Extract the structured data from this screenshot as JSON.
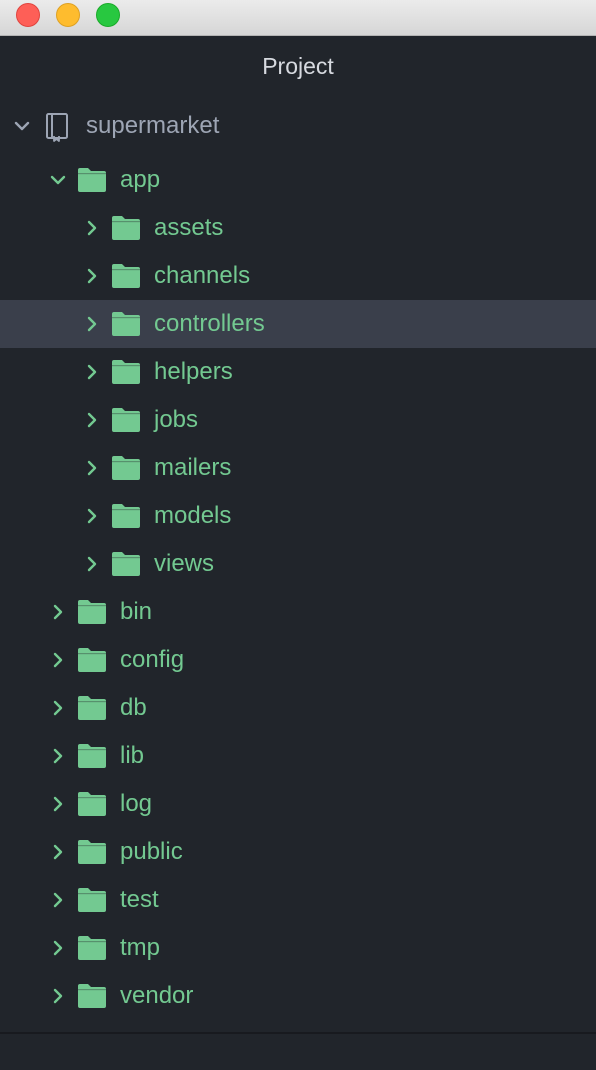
{
  "window": {
    "panel_title": "Project"
  },
  "tree": {
    "root": {
      "label": "supermarket",
      "expanded": true
    },
    "items": [
      {
        "label": "app",
        "depth": 1,
        "expanded": true,
        "selected": false
      },
      {
        "label": "assets",
        "depth": 2,
        "expanded": false,
        "selected": false
      },
      {
        "label": "channels",
        "depth": 2,
        "expanded": false,
        "selected": false
      },
      {
        "label": "controllers",
        "depth": 2,
        "expanded": false,
        "selected": true
      },
      {
        "label": "helpers",
        "depth": 2,
        "expanded": false,
        "selected": false
      },
      {
        "label": "jobs",
        "depth": 2,
        "expanded": false,
        "selected": false
      },
      {
        "label": "mailers",
        "depth": 2,
        "expanded": false,
        "selected": false
      },
      {
        "label": "models",
        "depth": 2,
        "expanded": false,
        "selected": false
      },
      {
        "label": "views",
        "depth": 2,
        "expanded": false,
        "selected": false
      },
      {
        "label": "bin",
        "depth": 1,
        "expanded": false,
        "selected": false
      },
      {
        "label": "config",
        "depth": 1,
        "expanded": false,
        "selected": false
      },
      {
        "label": "db",
        "depth": 1,
        "expanded": false,
        "selected": false
      },
      {
        "label": "lib",
        "depth": 1,
        "expanded": false,
        "selected": false
      },
      {
        "label": "log",
        "depth": 1,
        "expanded": false,
        "selected": false
      },
      {
        "label": "public",
        "depth": 1,
        "expanded": false,
        "selected": false
      },
      {
        "label": "test",
        "depth": 1,
        "expanded": false,
        "selected": false
      },
      {
        "label": "tmp",
        "depth": 1,
        "expanded": false,
        "selected": false
      },
      {
        "label": "vendor",
        "depth": 1,
        "expanded": false,
        "selected": false
      }
    ]
  },
  "colors": {
    "background": "#21252b",
    "folder": "#73c991",
    "label_git_added": "#73c991",
    "root_label": "#9da5b4",
    "selection": "#3a3f4b",
    "chevron_root": "#9da5b4",
    "chevron_item": "#73c991"
  },
  "icons": {
    "root": "repo-book-icon",
    "folder": "folder-icon",
    "expanded": "chevron-down-icon",
    "collapsed": "chevron-right-icon"
  }
}
